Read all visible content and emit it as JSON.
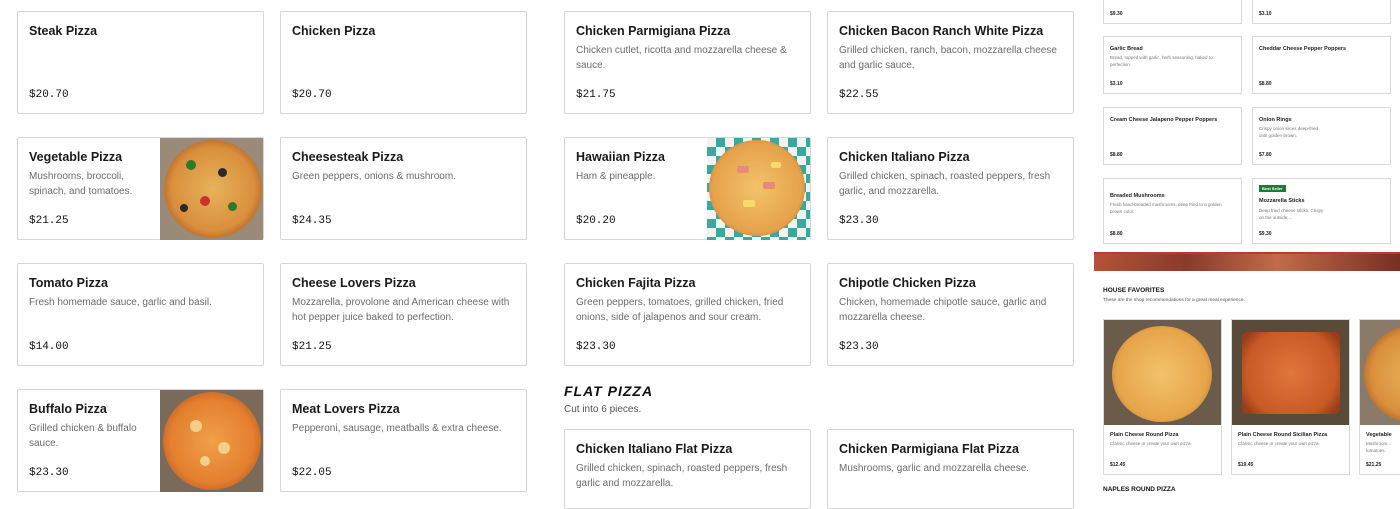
{
  "cards": [
    {
      "name": "Steak Pizza",
      "desc": "",
      "price": "$20.70"
    },
    {
      "name": "Chicken Pizza",
      "desc": "",
      "price": "$20.70"
    },
    {
      "name": "Chicken Parmigiana Pizza",
      "desc": "Chicken cutlet, ricotta and mozzarella cheese & sauce.",
      "price": "$21.75"
    },
    {
      "name": "Chicken Bacon Ranch White Pizza",
      "desc": "Grilled chicken, ranch, bacon, mozzarella cheese and garlic sauce.",
      "price": "$22.55"
    },
    {
      "name": "Vegetable Pizza",
      "desc": "Mushrooms, broccoli, spinach, and tomatoes.",
      "price": "$21.25"
    },
    {
      "name": "Cheesesteak Pizza",
      "desc": "Green peppers, onions & mushroom.",
      "price": "$24.35"
    },
    {
      "name": "Hawaiian Pizza",
      "desc": "Ham & pineapple.",
      "price": "$20.20"
    },
    {
      "name": "Chicken Italiano Pizza",
      "desc": "Grilled chicken, spinach, roasted peppers, fresh garlic, and mozzarella.",
      "price": "$23.30"
    },
    {
      "name": "Tomato Pizza",
      "desc": "Fresh homemade sauce, garlic and basil.",
      "price": "$14.00"
    },
    {
      "name": "Cheese Lovers Pizza",
      "desc": "Mozzarella, provolone and American cheese with hot pepper juice baked to perfection.",
      "price": "$21.25"
    },
    {
      "name": "Chicken Fajita Pizza",
      "desc": "Green peppers, tomatoes, grilled chicken, fried onions, side of jalapenos and sour cream.",
      "price": "$23.30"
    },
    {
      "name": "Chipotle Chicken Pizza",
      "desc": "Chicken, homemade chipotle sauce, garlic and mozzarella cheese.",
      "price": "$23.30"
    },
    {
      "name": "Buffalo Pizza",
      "desc": "Grilled chicken & buffalo sauce.",
      "price": "$23.30"
    },
    {
      "name": "Meat Lovers Pizza",
      "desc": "Pepperoni, sausage, meatballs & extra cheese.",
      "price": "$22.05"
    },
    {
      "name": "Chicken Italiano Flat Pizza",
      "desc": "Grilled chicken, spinach, roasted peppers, fresh garlic and mozzarella.",
      "price": ""
    },
    {
      "name": "Chicken Parmigiana Flat Pizza",
      "desc": "Mushrooms, garlic and mozzarella cheese.",
      "price": ""
    }
  ],
  "flat_section": {
    "title": "FLAT PIZZA",
    "subtitle": "Cut into 6 pieces."
  },
  "mini": {
    "top_prices": [
      "$9.30",
      "$3.10"
    ],
    "items": [
      {
        "name": "Garlic Bread",
        "desc": "Bread, topped with garlic, herb seasoning, baked to perfection.",
        "price": "$3.10"
      },
      {
        "name": "Cheddar Cheese Pepper Poppers",
        "desc": "",
        "price": "$8.80"
      },
      {
        "name": "Cream Cheese Jalapeno Pepper Poppers",
        "desc": "",
        "price": "$8.80"
      },
      {
        "name": "Onion Rings",
        "desc": "Crispy onion slices deep-fried until golden-brown.",
        "price": "$7.80"
      },
      {
        "name": "Breaded Mushrooms",
        "desc": "Fresh hand-breaded mushrooms, deep fried to a golden brown color.",
        "price": "$8.80"
      },
      {
        "name": "Mozzarella Sticks",
        "desc": "Deep fried cheese sticks. Crispy on the outside,...",
        "price": "$9.30",
        "badge": "Best Seller"
      }
    ],
    "favorites_title": "HOUSE FAVORITES",
    "favorites_sub": "These are the shop recommendations for a great meal experience.",
    "favorites": [
      {
        "name": "Plain Cheese Round Pizza",
        "desc": "Classic cheese or create your own pizza.",
        "price": "$12.45"
      },
      {
        "name": "Plain Cheese Round Sicilian Pizza",
        "desc": "Classic cheese or create your own pizza.",
        "price": "$19.45"
      },
      {
        "name": "Vegetable",
        "desc": "Mushroom... tomatoes.",
        "price": "$21.25"
      }
    ],
    "naples_title": "NAPLES ROUND PIZZA"
  },
  "colors": {
    "accent": "#c0392b",
    "badge": "#1f7a3a"
  }
}
